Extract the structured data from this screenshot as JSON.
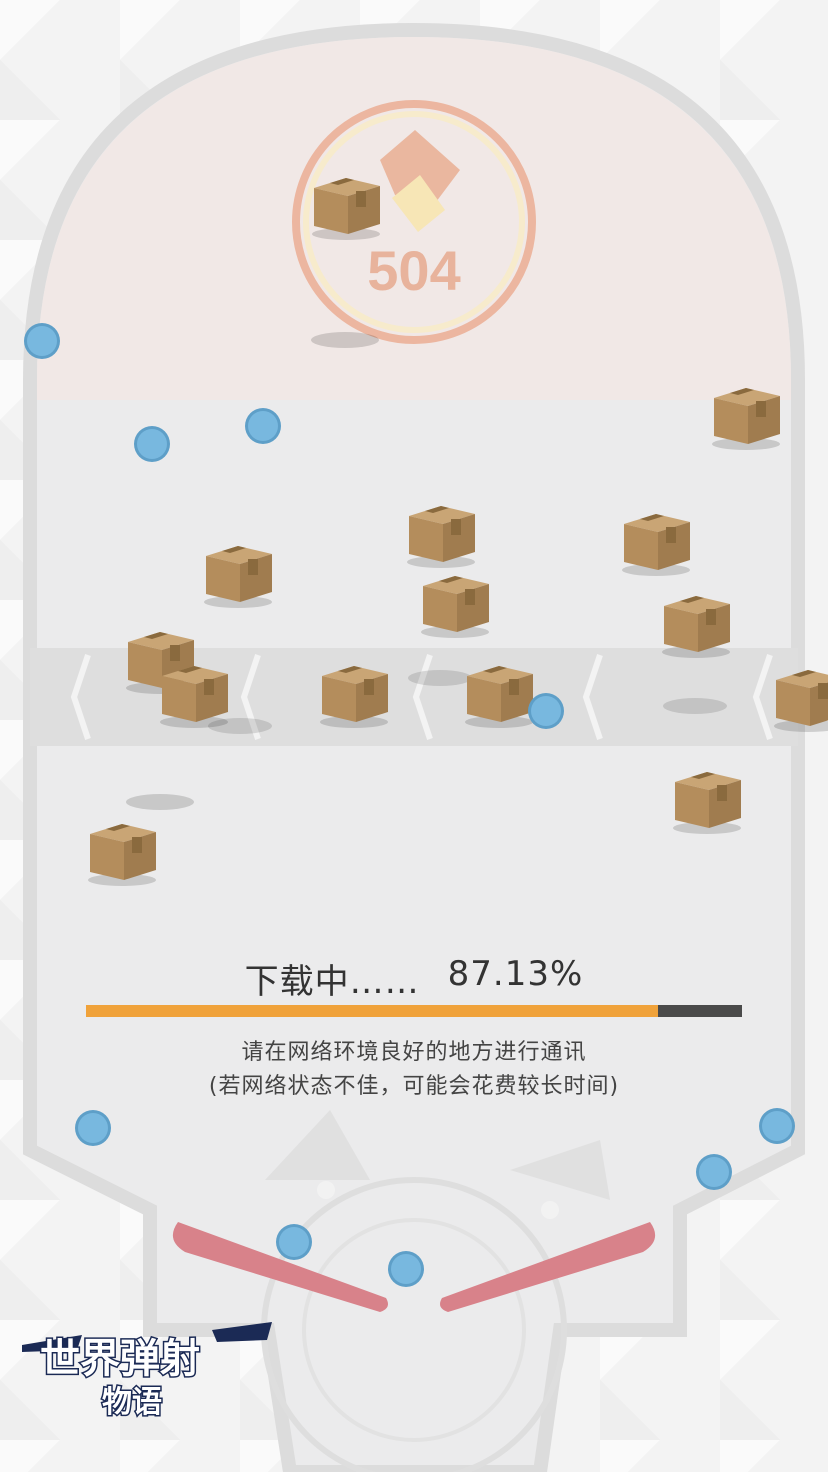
{
  "score_badge": {
    "value": "504"
  },
  "loading": {
    "label": "下载中……",
    "percent_text": "87.13%",
    "progress": 0.8713,
    "note_line1": "请在网络环境良好的地方进行通讯",
    "note_line2": "(若网络状态不佳，可能会花费较长时间)"
  },
  "logo": {
    "text": "世界弹射物语"
  },
  "colors": {
    "progress_fill": "#f0a23a",
    "progress_track": "#4a4a4a",
    "ball": "#6fb3dc",
    "flipper": "#d8828a",
    "box": "#b58f5d"
  },
  "icons": [
    "cardboard-box-icon",
    "ball-icon",
    "flipper-icon",
    "score-badge-icon",
    "chevron-left-icon"
  ]
}
